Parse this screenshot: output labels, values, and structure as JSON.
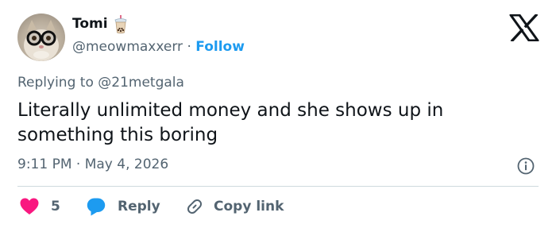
{
  "author": {
    "display_name": "Tomi",
    "name_emoji": "bubble-tea-icon",
    "handle": "@meowmaxxerr",
    "separator": "·",
    "follow_label": "Follow",
    "avatar": "cat-with-glasses-avatar"
  },
  "platform": {
    "logo": "x-logo-icon"
  },
  "tweet": {
    "replying_to_prefix": "Replying to",
    "replying_to_handle": "@21metgala",
    "text": "Literally unlimited money and she shows up in something this boring",
    "timestamp": "9:11 PM · May 4, 2026"
  },
  "actions": {
    "like_count": "5",
    "reply_label": "Reply",
    "copy_link_label": "Copy link"
  },
  "colors": {
    "accent": "#1d9bf0",
    "like": "#f91880",
    "secondary_text": "#536471",
    "primary_text": "#0f1419",
    "divider": "#cfd9de"
  }
}
